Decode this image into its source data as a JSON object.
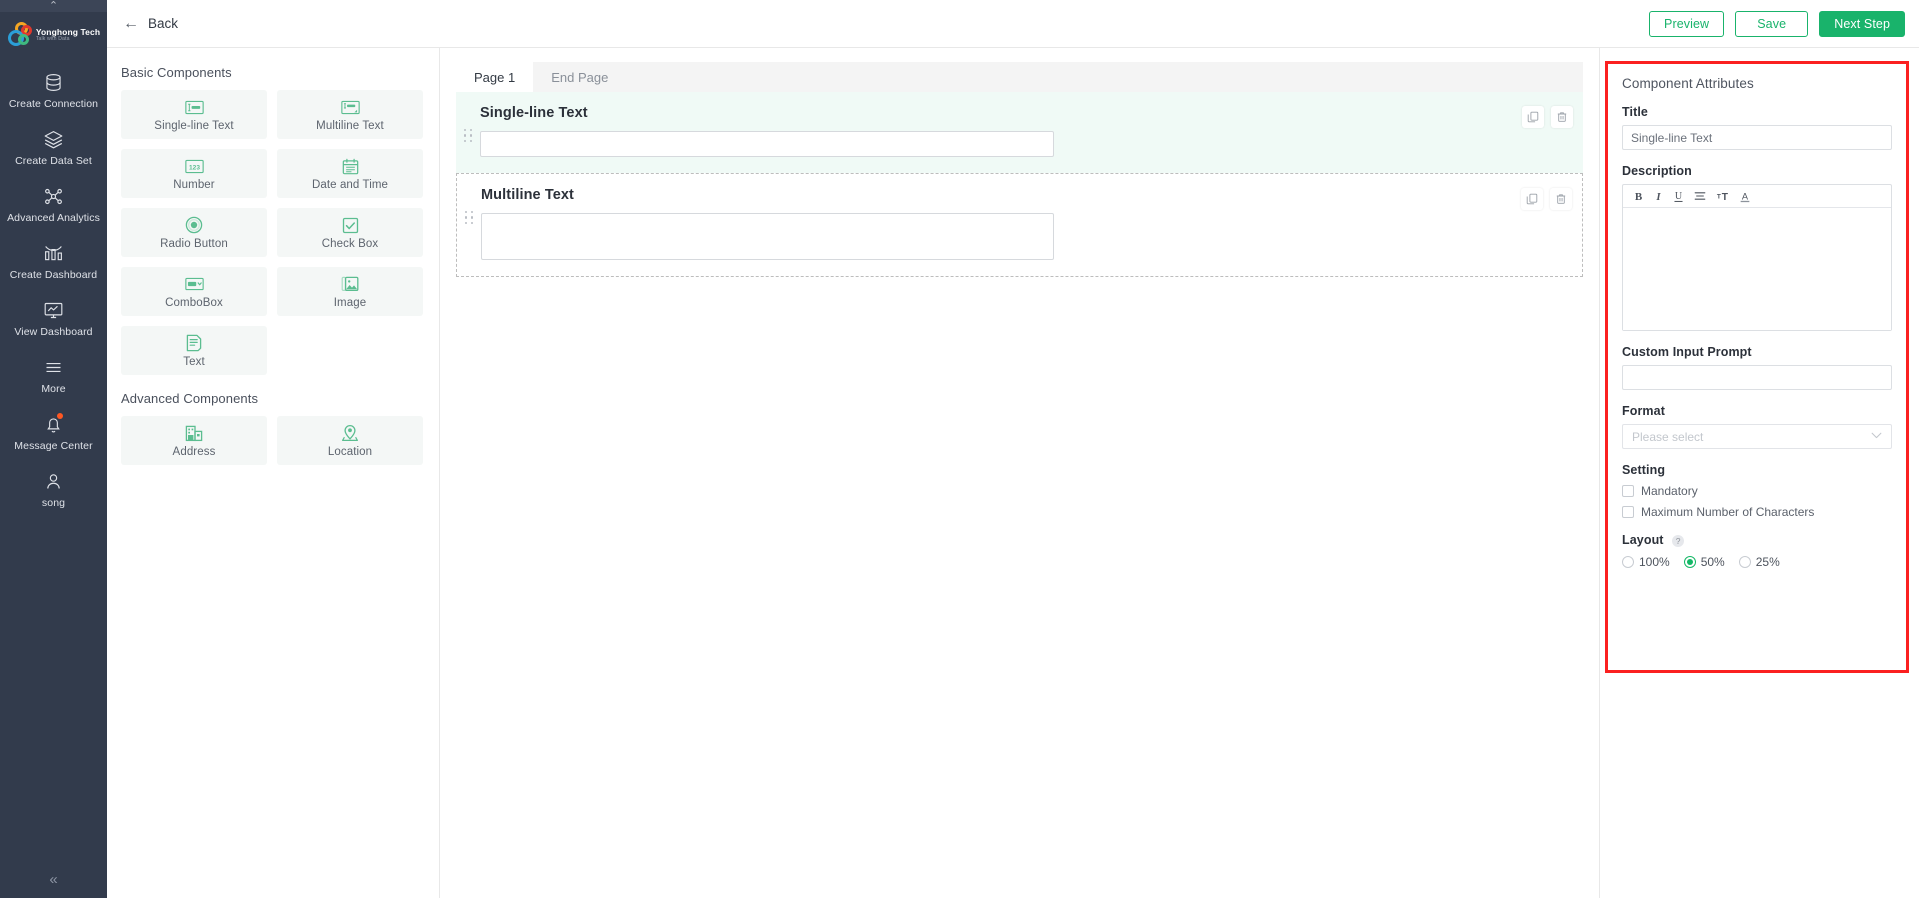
{
  "nav": {
    "logo": {
      "title": "Yonghong Tech",
      "subtitle": "Talk with Data"
    },
    "items": [
      {
        "label": "Create Connection",
        "icon": "database-icon"
      },
      {
        "label": "Create Data Set",
        "icon": "layers-icon"
      },
      {
        "label": "Advanced Analytics",
        "icon": "network-nodes-icon"
      },
      {
        "label": "Create Dashboard",
        "icon": "bar-chart-icon"
      },
      {
        "label": "View Dashboard",
        "icon": "monitor-chart-icon"
      },
      {
        "label": "More",
        "icon": "hamburger-icon"
      },
      {
        "label": "Message Center",
        "icon": "bell-icon",
        "badge": true
      },
      {
        "label": "song",
        "icon": "user-icon"
      }
    ],
    "collapse_glyph": "«",
    "expand_glyph": "⌃"
  },
  "topbar": {
    "back_label": "Back",
    "back_glyph": "←",
    "preview_label": "Preview",
    "save_label": "Save",
    "next_step_label": "Next Step"
  },
  "palette": {
    "basic_title": "Basic Components",
    "advanced_title": "Advanced Components",
    "basic": [
      {
        "label": "Single-line Text",
        "icon": "single-line-text-icon"
      },
      {
        "label": "Multiline Text",
        "icon": "multiline-text-icon"
      },
      {
        "label": "Number",
        "icon": "number-123-icon"
      },
      {
        "label": "Date and Time",
        "icon": "calendar-icon"
      },
      {
        "label": "Radio Button",
        "icon": "radio-button-icon"
      },
      {
        "label": "Check Box",
        "icon": "check-box-icon"
      },
      {
        "label": "ComboBox",
        "icon": "combobox-icon"
      },
      {
        "label": "Image",
        "icon": "image-icon"
      },
      {
        "label": "Text",
        "icon": "text-document-icon"
      }
    ],
    "advanced": [
      {
        "label": "Address",
        "icon": "building-address-icon"
      },
      {
        "label": "Location",
        "icon": "map-pin-location-icon"
      }
    ]
  },
  "canvas": {
    "tabs": [
      {
        "label": "Page 1",
        "active": true
      },
      {
        "label": "End Page",
        "active": false
      }
    ],
    "fields": [
      {
        "label": "Single-line Text",
        "type": "input",
        "selected": true
      },
      {
        "label": "Multiline Text",
        "type": "textarea",
        "selected": false
      }
    ],
    "row_actions": {
      "copy": "copy-icon",
      "delete": "trash-icon"
    }
  },
  "attributes": {
    "panel_title": "Component Attributes",
    "title_label": "Title",
    "title_value": "Single-line Text",
    "description_label": "Description",
    "rte_buttons": [
      "bold-icon",
      "italic-icon",
      "underline-icon",
      "align-left-icon",
      "font-size-icon",
      "font-color-icon"
    ],
    "custom_input_prompt_label": "Custom Input Prompt",
    "custom_input_prompt_value": "",
    "format_label": "Format",
    "format_placeholder": "Please select",
    "setting_label": "Setting",
    "settings": [
      {
        "label": "Mandatory",
        "checked": false
      },
      {
        "label": "Maximum Number of Characters",
        "checked": false
      }
    ],
    "layout_label": "Layout",
    "layout_help_glyph": "?",
    "layout_options": [
      {
        "label": "100%",
        "selected": false
      },
      {
        "label": "50%",
        "selected": true
      },
      {
        "label": "25%",
        "selected": false
      }
    ]
  },
  "colors": {
    "accent_green": "#19b36b",
    "nav_bg": "#323b4c",
    "highlight_red": "#fb2020",
    "selected_row_bg": "#f0faf6",
    "palette_card_bg": "#f4f7f6",
    "component_icon_green": "#5bbd90"
  }
}
